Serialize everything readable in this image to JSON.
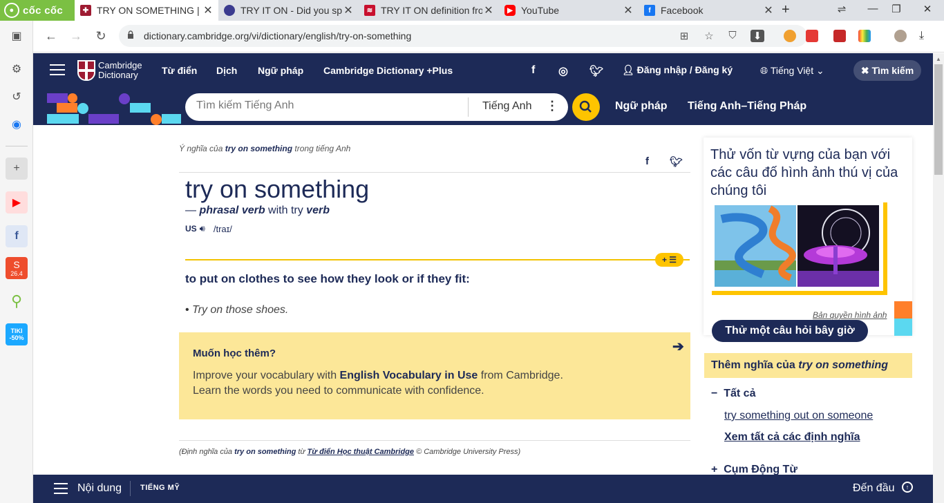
{
  "browser": {
    "brand": "cốc cốc",
    "tabs": [
      {
        "title": "TRY ON SOMETHING | Ý",
        "icon": "cambridge-favicon",
        "active": true
      },
      {
        "title": "TRY IT ON - Did you spe",
        "icon": "globe-favicon"
      },
      {
        "title": "TRY IT ON definition fro",
        "icon": "collins-favicon"
      },
      {
        "title": "YouTube",
        "icon": "youtube-favicon"
      },
      {
        "title": "Facebook",
        "icon": "facebook-favicon"
      }
    ],
    "url": "dictionary.cambridge.org/vi/dictionary/english/try-on-something"
  },
  "sidebar": {
    "badges": {
      "shopee": "26.4",
      "tiki": "TIKI -50%"
    }
  },
  "header": {
    "logo_line1": "Cambridge",
    "logo_line2": "Dictionary",
    "nav": [
      "Từ điển",
      "Dịch",
      "Ngữ pháp",
      "Cambridge Dictionary +Plus"
    ],
    "login": "Đăng nhập / Đăng ký",
    "language": "Tiếng Việt",
    "search_button": "Tìm kiếm"
  },
  "searchbar": {
    "placeholder": "Tìm kiếm Tiếng Anh",
    "dictionary": "Tiếng Anh",
    "links": [
      "Ngữ pháp",
      "Tiếng Anh–Tiếng Pháp"
    ]
  },
  "entry": {
    "breadcrumb_pre": "Ý nghĩa của ",
    "breadcrumb_word": "try on something",
    "breadcrumb_post": " trong tiếng Anh",
    "headword": "try on something",
    "pos_dash": "— ",
    "pos": "phrasal verb",
    "pos_with": " with try ",
    "pos_verb": "verb",
    "region": "US",
    "ipa": "/traɪ/",
    "definition": "to put on clothes to see how they look or if they fit:",
    "example_bullet": "• ",
    "example": "Try on those shoes."
  },
  "promo": {
    "title": "Muốn học thêm?",
    "line1_pre": "Improve your vocabulary with ",
    "line1_bold": "English Vocabulary in Use",
    "line1_post": " from Cambridge.",
    "line2": "Learn the words you need to communicate with confidence."
  },
  "source": {
    "pre": "(Định nghĩa của ",
    "word": "try on something",
    "mid": " từ ",
    "dict": "Từ điển Học thuật Cambridge",
    "post": " © Cambridge University Press)"
  },
  "quiz": {
    "title": "Thử vốn từ vựng của bạn với các câu đố hình ảnh thú vị của chúng tôi",
    "credit": "Bản quyền hình ảnh",
    "button": "Thử một câu hỏi bây giờ"
  },
  "more": {
    "title_pre": "Thêm nghĩa của ",
    "title_word": "try on something",
    "all": "Tất cả",
    "related": "try something out on someone",
    "see_all": "Xem tất cả các định nghĩa",
    "phrasal": "Cụm Động Từ"
  },
  "bottombar": {
    "content": "Nội dung",
    "us": "TIẾNG MỸ",
    "top": "Đến đầu"
  }
}
